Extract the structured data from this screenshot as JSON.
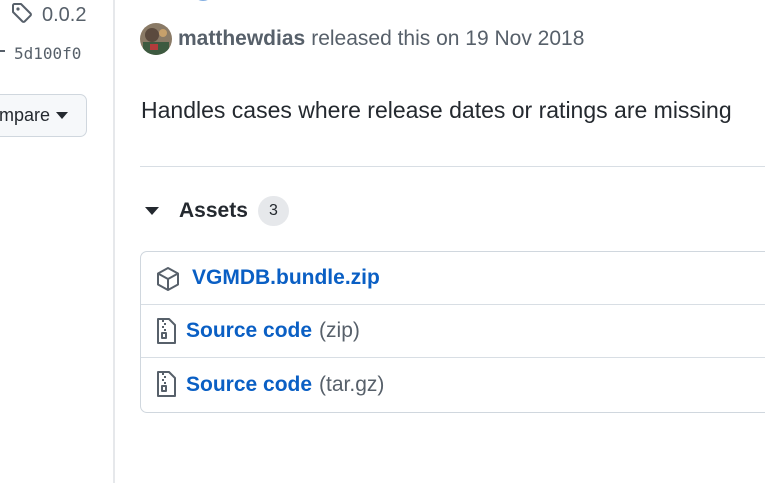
{
  "sidebar": {
    "tag": {
      "icon": "tag-icon",
      "label": "0.0.2"
    },
    "commit": {
      "icon": "git-commit-icon",
      "hash": "5d100f0"
    },
    "compare_label": "mpare"
  },
  "release": {
    "author": "matthewdias",
    "released_text": "released this on 19 Nov 2018",
    "description": "Handles cases where release dates or ratings are missing"
  },
  "assets": {
    "title": "Assets",
    "count": "3",
    "items": [
      {
        "icon": "package-icon",
        "name": "VGMDB.bundle.zip",
        "suffix": ""
      },
      {
        "icon": "file-zip-icon",
        "name": "Source code",
        "suffix": "(zip)"
      },
      {
        "icon": "file-zip-icon",
        "name": "Source code",
        "suffix": "(tar.gz)"
      }
    ]
  },
  "colors": {
    "link": "#0a5fc4",
    "muted": "#57606a",
    "border": "#d0d7de",
    "counter_bg": "#e6e8eb"
  }
}
